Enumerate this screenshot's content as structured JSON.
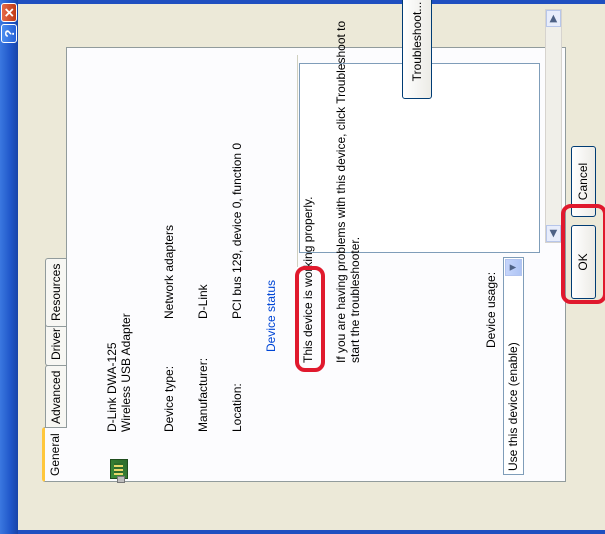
{
  "titlebar": {
    "help_label": "?",
    "close_label": "✕"
  },
  "tabs": [
    {
      "label": "General"
    },
    {
      "label": "Advanced"
    },
    {
      "label": "Driver"
    },
    {
      "label": "Resources"
    }
  ],
  "device": {
    "name": "D-Link DWA-125",
    "description": "Wireless USB Adapter",
    "icon": "network-adapter-icon"
  },
  "properties": {
    "type_label": "Device type:",
    "type_value": "Network adapters",
    "manufacturer_label": "Manufacturer:",
    "manufacturer_value": "D-Link",
    "location_label": "Location:",
    "location_value": "PCI bus 129, device 0, function 0"
  },
  "status": {
    "heading": "Device status",
    "line1": "This device is working properly.",
    "line2": "If you are having problems with this device, click Troubleshoot to",
    "line3": "start the troubleshooter.",
    "troubleshoot_label": "Troubleshoot..."
  },
  "usage": {
    "label": "Device usage:",
    "value": "Use this device (enable)"
  },
  "buttons": {
    "ok_label": "OK",
    "cancel_label": "Cancel"
  },
  "colors": {
    "highlight": "#e0192d",
    "titlebar": "#1f56c9",
    "link_blue": "#0046d5"
  }
}
